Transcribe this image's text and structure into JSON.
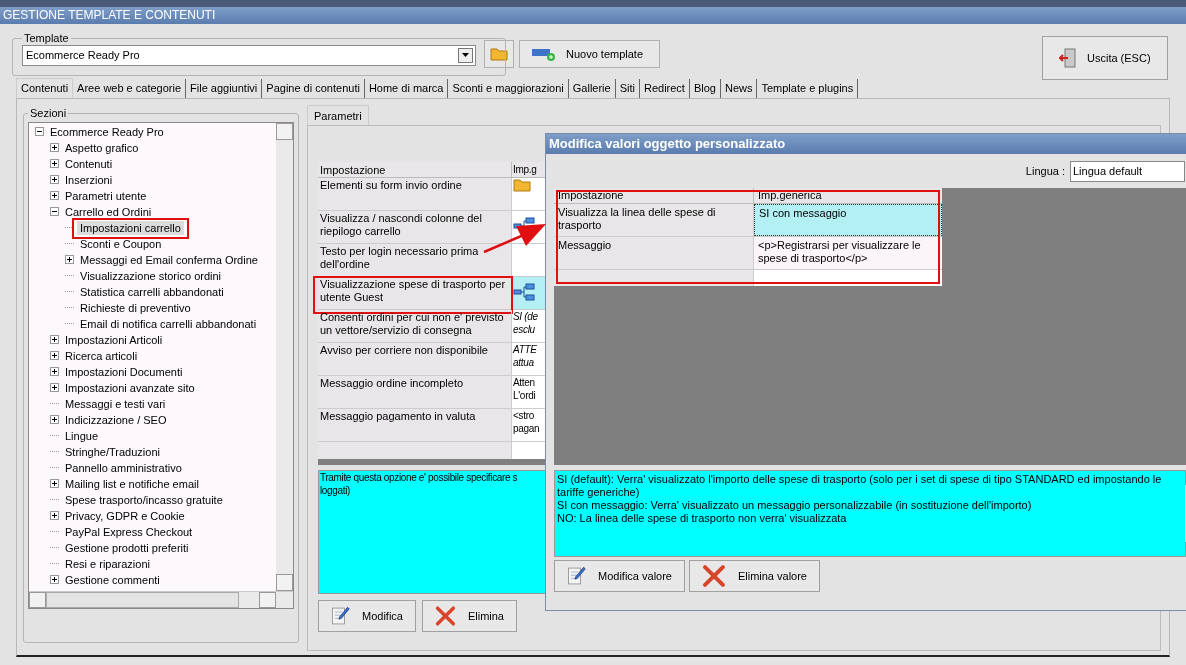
{
  "window": {
    "title": "GESTIONE TEMPLATE E CONTENUTI"
  },
  "template": {
    "label": "Template",
    "value": "Ecommerce Ready Pro"
  },
  "new_template_button": "Nuovo template",
  "exit_button": "Uscita (ESC)",
  "tabs": [
    {
      "label": "Contenuti",
      "selected": true
    },
    {
      "label": "Aree web e categorie",
      "selected": false
    },
    {
      "label": "File aggiuntivi",
      "selected": false
    },
    {
      "label": "Pagine di contenuti",
      "selected": false
    },
    {
      "label": "Home di marca",
      "selected": false
    },
    {
      "label": "Sconti e maggiorazioni",
      "selected": false
    },
    {
      "label": "Gallerie",
      "selected": false
    },
    {
      "label": "Siti",
      "selected": false
    },
    {
      "label": "Redirect",
      "selected": false
    },
    {
      "label": "Blog",
      "selected": false
    },
    {
      "label": "News",
      "selected": false
    },
    {
      "label": "Template e plugins",
      "selected": false
    }
  ],
  "sections": {
    "label": "Sezioni",
    "tree": [
      {
        "label": "Ecommerce Ready Pro",
        "kind": "branch",
        "selected": false,
        "highlighted": false,
        "children": [
          {
            "label": "Aspetto grafico",
            "kind": "branch",
            "selected": false,
            "highlighted": false
          },
          {
            "label": "Contenuti",
            "kind": "branch",
            "selected": false,
            "highlighted": false
          },
          {
            "label": "Inserzioni",
            "kind": "branch",
            "selected": false,
            "highlighted": false
          },
          {
            "label": "Parametri utente",
            "kind": "branch",
            "selected": false,
            "highlighted": false
          },
          {
            "label": "Carrello ed Ordini",
            "kind": "branch",
            "selected": false,
            "highlighted": false,
            "children": [
              {
                "label": "Impostazioni carrello",
                "kind": "leaf",
                "selected": true,
                "highlighted": true
              },
              {
                "label": "Sconti e Coupon",
                "kind": "leaf",
                "selected": false,
                "highlighted": false
              },
              {
                "label": "Messaggi ed Email conferma Ordine",
                "kind": "branch",
                "selected": false,
                "highlighted": false
              },
              {
                "label": "Visualizzazione storico ordini",
                "kind": "leaf",
                "selected": false,
                "highlighted": false
              },
              {
                "label": "Statistica carrelli abbandonati",
                "kind": "leaf",
                "selected": false,
                "highlighted": false
              },
              {
                "label": "Richieste di preventivo",
                "kind": "leaf",
                "selected": false,
                "highlighted": false
              },
              {
                "label": "Email di notifica carrelli abbandonati",
                "kind": "leaf",
                "selected": false,
                "highlighted": false
              }
            ]
          },
          {
            "label": "Impostazioni Articoli",
            "kind": "branch",
            "selected": false,
            "highlighted": false
          },
          {
            "label": "Ricerca articoli",
            "kind": "branch",
            "selected": false,
            "highlighted": false
          },
          {
            "label": "Impostazioni Documenti",
            "kind": "branch",
            "selected": false,
            "highlighted": false
          },
          {
            "label": "Impostazioni avanzate sito",
            "kind": "branch",
            "selected": false,
            "highlighted": false
          },
          {
            "label": "Messaggi e testi vari",
            "kind": "leaf",
            "selected": false,
            "highlighted": false
          },
          {
            "label": "Indicizzazione / SEO",
            "kind": "branch",
            "selected": false,
            "highlighted": false
          },
          {
            "label": "Lingue",
            "kind": "leaf",
            "selected": false,
            "highlighted": false
          },
          {
            "label": "Stringhe/Traduzioni",
            "kind": "leaf",
            "selected": false,
            "highlighted": false
          },
          {
            "label": "Pannello amministrativo",
            "kind": "leaf",
            "selected": false,
            "highlighted": false
          },
          {
            "label": "Mailing list e notifiche email",
            "kind": "branch",
            "selected": false,
            "highlighted": false
          },
          {
            "label": "Spese trasporto/incasso gratuite",
            "kind": "leaf",
            "selected": false,
            "highlighted": false
          },
          {
            "label": "Privacy, GDPR e Cookie",
            "kind": "branch",
            "selected": false,
            "highlighted": false
          },
          {
            "label": "PayPal Express Checkout",
            "kind": "leaf",
            "selected": false,
            "highlighted": false
          },
          {
            "label": "Gestione prodotti preferiti",
            "kind": "leaf",
            "selected": false,
            "highlighted": false
          },
          {
            "label": "Resi e riparazioni",
            "kind": "leaf",
            "selected": false,
            "highlighted": false
          },
          {
            "label": "Gestione commenti",
            "kind": "branch",
            "selected": false,
            "highlighted": false
          }
        ]
      }
    ]
  },
  "params_tab": {
    "label": "Parametri",
    "selected": true
  },
  "params_table": {
    "columns": [
      "Impostazione",
      "Imp.g"
    ],
    "rows": [
      {
        "label": "Elementi su form invio ordine",
        "kind": "folder",
        "value_lines": [],
        "selected": false,
        "highlighted": false
      },
      {
        "label": "Visualizza / nascondi colonne del riepilogo carrello",
        "kind": "tree",
        "value_lines": [],
        "selected": false,
        "highlighted": false
      },
      {
        "label": "Testo per login necessario prima dell'ordine",
        "kind": "text",
        "value_lines": [],
        "selected": false,
        "highlighted": false
      },
      {
        "label": "Visualizzazione spese di trasporto per utente Guest",
        "kind": "tree",
        "value_lines": [],
        "selected": true,
        "highlighted": true
      },
      {
        "label": "Consenti ordini per cui non e' previsto un vettore/servizio di consegna",
        "kind": "text",
        "value_lines": [
          "SI (de",
          "esclu"
        ],
        "italic": true,
        "selected": false,
        "highlighted": false
      },
      {
        "label": "Avviso per corriere non disponibile",
        "kind": "text",
        "value_lines": [
          "ATTE",
          "attua"
        ],
        "italic": true,
        "selected": false,
        "highlighted": false
      },
      {
        "label": "Messaggio ordine incompleto",
        "kind": "text",
        "value_lines": [
          "Atten",
          "L'ordi"
        ],
        "italic": false,
        "selected": false,
        "highlighted": false
      },
      {
        "label": "Messaggio pagamento in valuta",
        "kind": "text",
        "value_lines": [
          "<stro",
          "pagan"
        ],
        "italic": false,
        "selected": false,
        "highlighted": false
      }
    ]
  },
  "params_description": [
    "Tramite questa opzione e' possibile specificare s",
    "loggati)"
  ],
  "params_buttons": [
    {
      "label": "Modifica",
      "kind": "edit"
    },
    {
      "label": "Elimina",
      "kind": "delete"
    }
  ],
  "dialog": {
    "title": "Modifica valori oggetto personalizzato",
    "language_label": "Lingua :",
    "language_value": "Lingua default",
    "highlighted": true,
    "columns": [
      "Impostazione",
      "Imp.generica"
    ],
    "rows": [
      {
        "label": "Visualizza la linea delle spese di trasporto",
        "value": "SI con messaggio",
        "selected": true
      },
      {
        "label": "Messaggio",
        "value": "<p>Registrarsi per visualizzare le spese di trasporto</p>",
        "selected": false
      }
    ],
    "description": [
      "SI (default): Verra' visualizzato l'importo delle spese di trasporto (solo per i set di spese di tipo STANDARD ed impostando le tariffe generiche)",
      "SI con messaggio: Verra' visualizzato un messaggio personalizzabile (in sostituzione dell'importo)",
      "NO: La linea delle spese di trasporto non verra' visualizzata"
    ],
    "buttons": [
      {
        "label": "Modifica valore",
        "kind": "edit"
      },
      {
        "label": "Elimina valore",
        "kind": "delete"
      }
    ]
  }
}
